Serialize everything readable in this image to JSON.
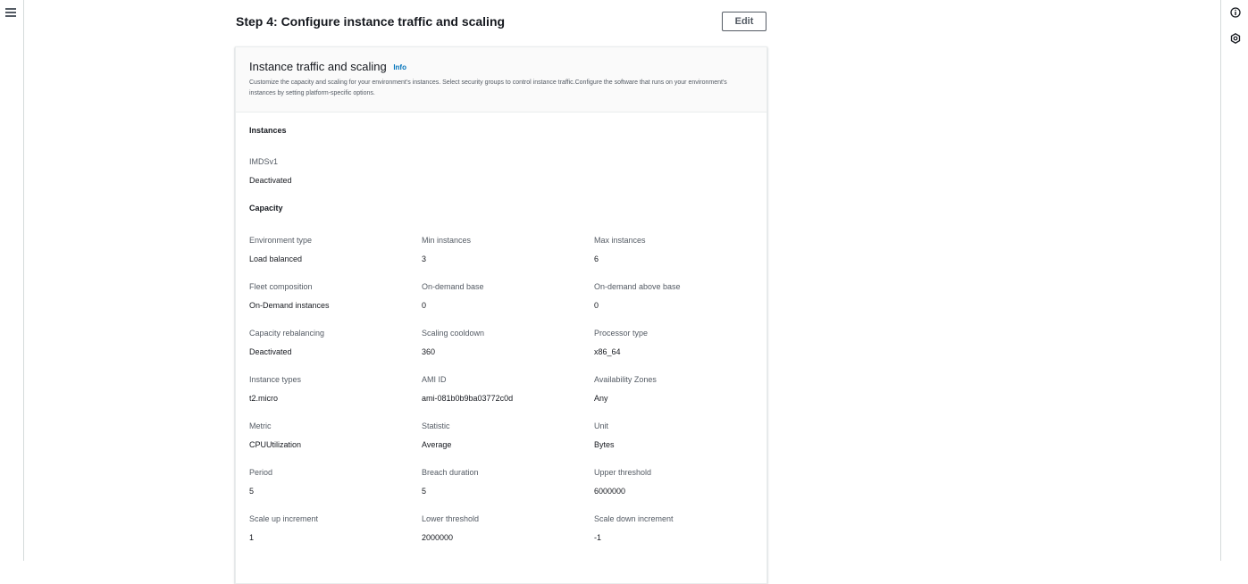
{
  "left_rail": {
    "menu_icon": "hamburger-menu-icon"
  },
  "right_rail": {
    "icons": [
      "info-circle-icon",
      "settings-icon"
    ]
  },
  "step": {
    "title": "Step 4: Configure instance traffic and scaling",
    "edit_label": "Edit"
  },
  "panel": {
    "title": "Instance traffic and scaling",
    "info_label": "Info",
    "description": "Customize the capacity and scaling for your environment's instances. Select security groups to control instance traffic.Configure the software that runs on your environment's instances by setting platform-specific options."
  },
  "instances": {
    "heading": "Instances",
    "fields": [
      {
        "label": "IMDSv1",
        "value": "Deactivated"
      }
    ]
  },
  "capacity": {
    "heading": "Capacity",
    "fields": [
      {
        "label": "Environment type",
        "value": "Load balanced"
      },
      {
        "label": "Min instances",
        "value": "3"
      },
      {
        "label": "Max instances",
        "value": "6"
      },
      {
        "label": "Fleet composition",
        "value": "On-Demand instances"
      },
      {
        "label": "On-demand base",
        "value": "0"
      },
      {
        "label": "On-demand above base",
        "value": "0"
      },
      {
        "label": "Capacity rebalancing",
        "value": "Deactivated"
      },
      {
        "label": "Scaling cooldown",
        "value": "360"
      },
      {
        "label": "Processor type",
        "value": "x86_64"
      },
      {
        "label": "Instance types",
        "value": "t2.micro"
      },
      {
        "label": "AMI ID",
        "value": "ami-081b0b9ba03772c0d"
      },
      {
        "label": "Availability Zones",
        "value": "Any"
      },
      {
        "label": "Metric",
        "value": "CPUUtilization"
      },
      {
        "label": "Statistic",
        "value": "Average"
      },
      {
        "label": "Unit",
        "value": "Bytes"
      },
      {
        "label": "Period",
        "value": "5"
      },
      {
        "label": "Breach duration",
        "value": "5"
      },
      {
        "label": "Upper threshold",
        "value": "6000000"
      },
      {
        "label": "Scale up increment",
        "value": "1"
      },
      {
        "label": "Lower threshold",
        "value": "2000000"
      },
      {
        "label": "Scale down increment",
        "value": "-1"
      }
    ]
  },
  "colors": {
    "text_primary": "#16191f",
    "text_secondary": "#545b64",
    "link": "#0073bb",
    "panel_header_bg": "#fafafa",
    "border": "#eaeded"
  }
}
